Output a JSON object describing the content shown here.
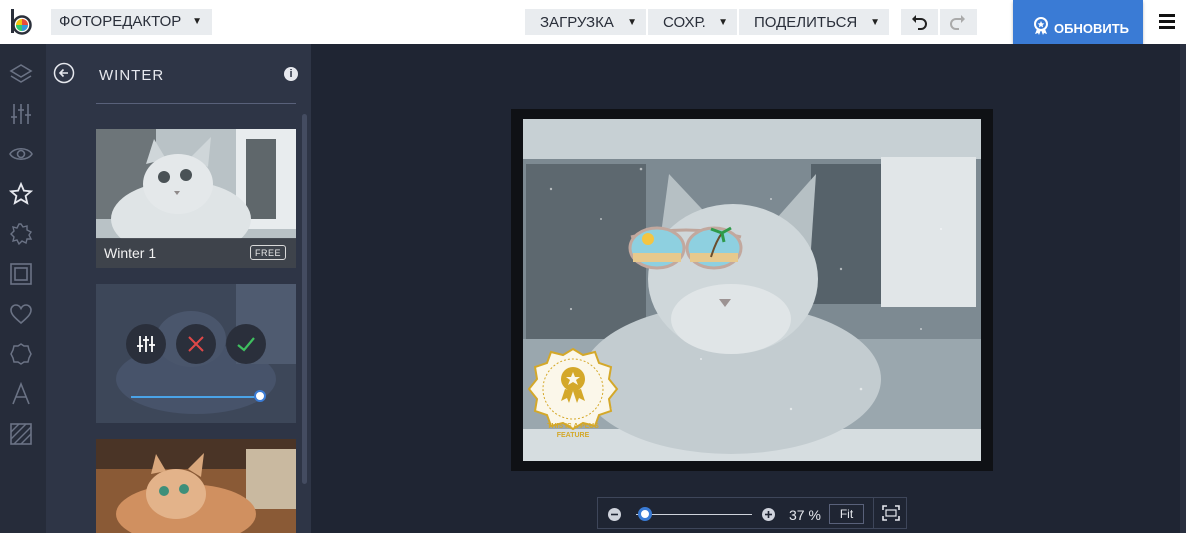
{
  "topbar": {
    "app_mode": "ФОТОРЕДАКТОР",
    "load_label": "ЗАГРУЗКА",
    "save_label": "СОХР.",
    "share_label": "ПОДЕЛИТЬСЯ",
    "update_label": "ОБНОВИТЬ"
  },
  "rail": {
    "items": [
      "layers-icon",
      "adjust-icon",
      "eye-icon",
      "star-icon",
      "sticker-icon",
      "frame-icon",
      "heart-icon",
      "badge-icon",
      "text-icon",
      "texture-icon"
    ],
    "active": "star-icon"
  },
  "panel": {
    "title": "WINTER",
    "info_glyph": "i",
    "cards": [
      {
        "name": "Winter 1",
        "badge": "FREE"
      }
    ],
    "active_card": {
      "intensity": 1.0
    }
  },
  "canvas": {
    "badge_line1": "THIS IS A PLUS",
    "badge_line2": "FEATURE"
  },
  "zoom": {
    "value": "37 %",
    "fit_label": "Fit",
    "level": 0.07
  },
  "colors": {
    "accent": "#3a7bd5",
    "canvas_bg": "#1f2533",
    "panel_bg": "#2e3546",
    "rail_bg": "#262c3a",
    "cancel": "#e04848",
    "apply": "#3fbf5f",
    "badge_gold": "#d4a82a"
  }
}
